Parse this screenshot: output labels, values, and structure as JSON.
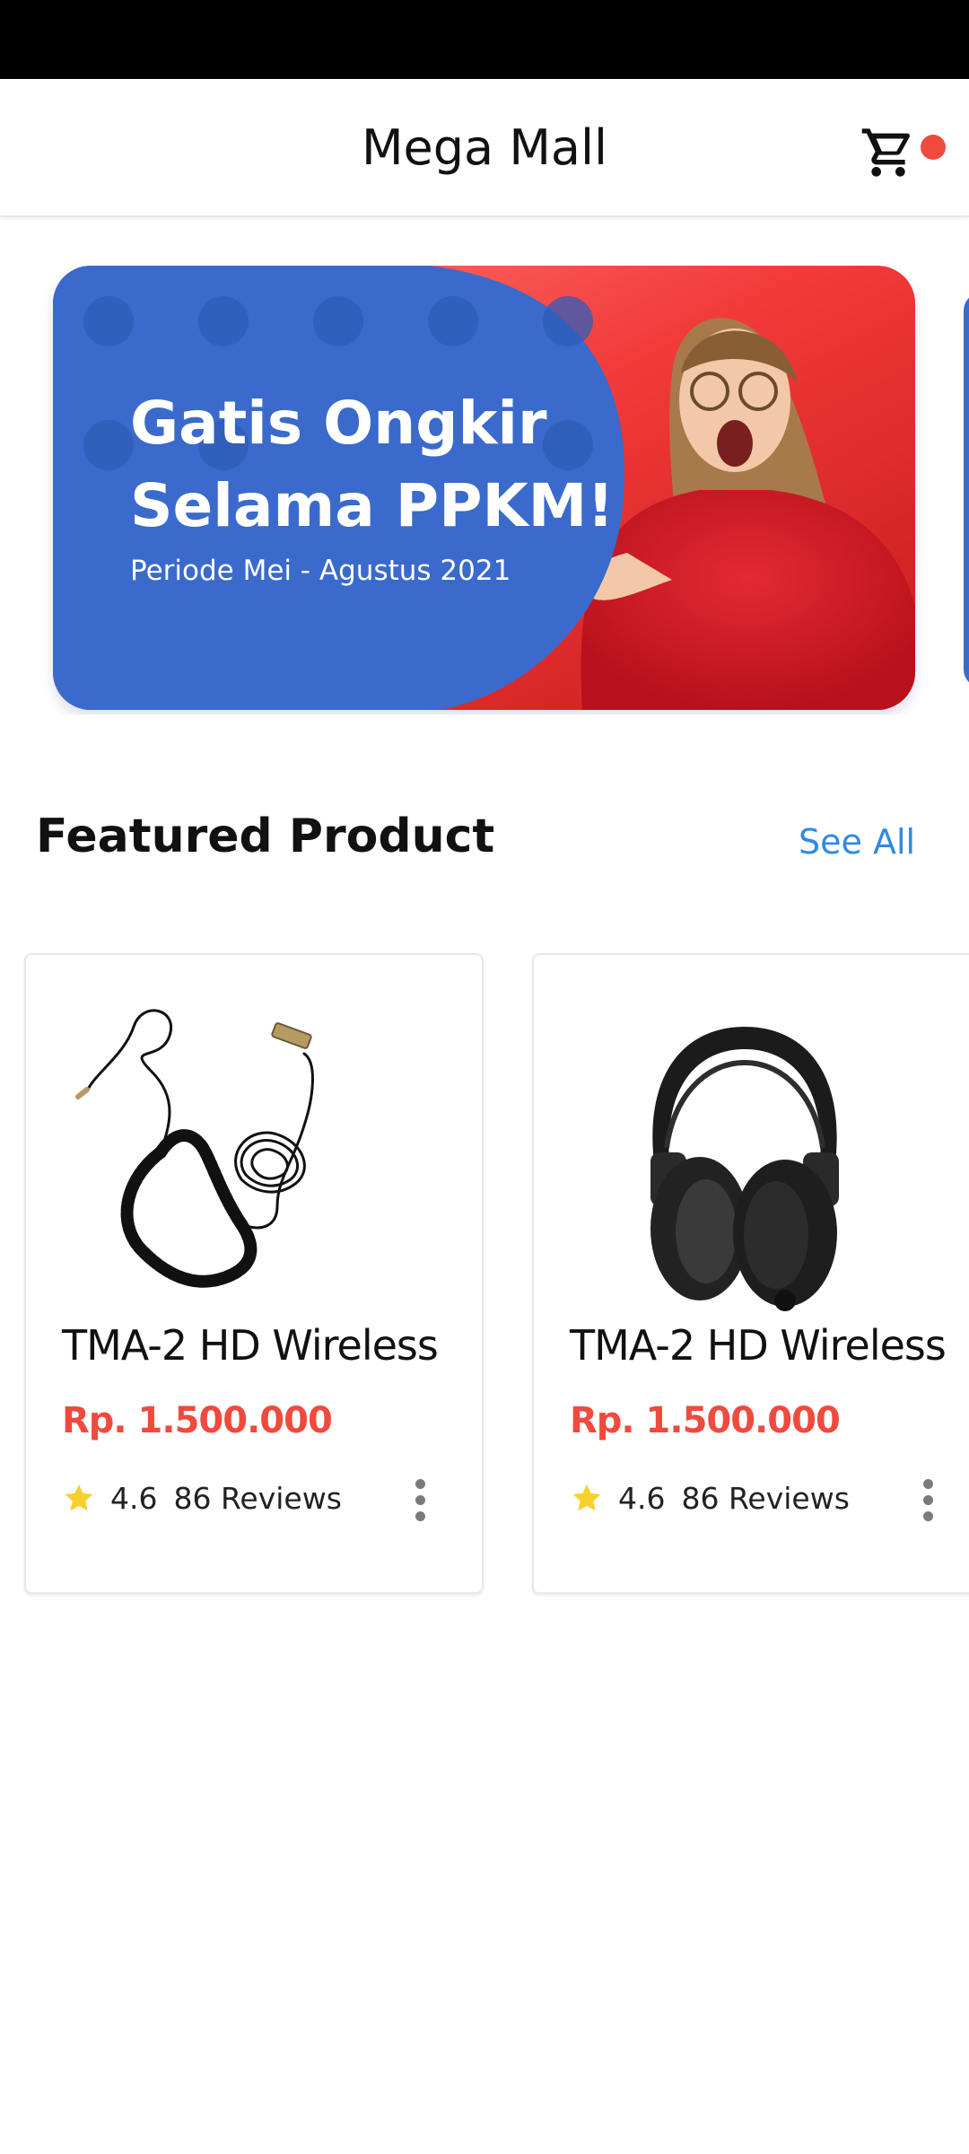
{
  "app": {
    "title": "Mega Mall",
    "cart_icon": "cart-icon",
    "badge_color": "#f04a3e"
  },
  "banner": {
    "title_line1": "Gatis Ongkir",
    "title_line2": "Selama PPKM!",
    "subtitle": "Periode Mei - Agustus 2021",
    "primary_color": "#3a6acb",
    "accent_color": "#ef3b3b"
  },
  "featured": {
    "title": "Featured Product",
    "see_all": "See All",
    "link_color": "#2f8ae0",
    "price_color": "#f04a3e",
    "products": [
      {
        "image": "coiled-cable-image",
        "name": "TMA-2 HD Wireless",
        "price": "Rp. 1.500.000",
        "rating": "4.6",
        "reviews": "86 Reviews"
      },
      {
        "image": "headphones-image",
        "name": "TMA-2 HD Wireless",
        "price": "Rp. 1.500.000",
        "rating": "4.6",
        "reviews": "86 Reviews"
      }
    ]
  }
}
